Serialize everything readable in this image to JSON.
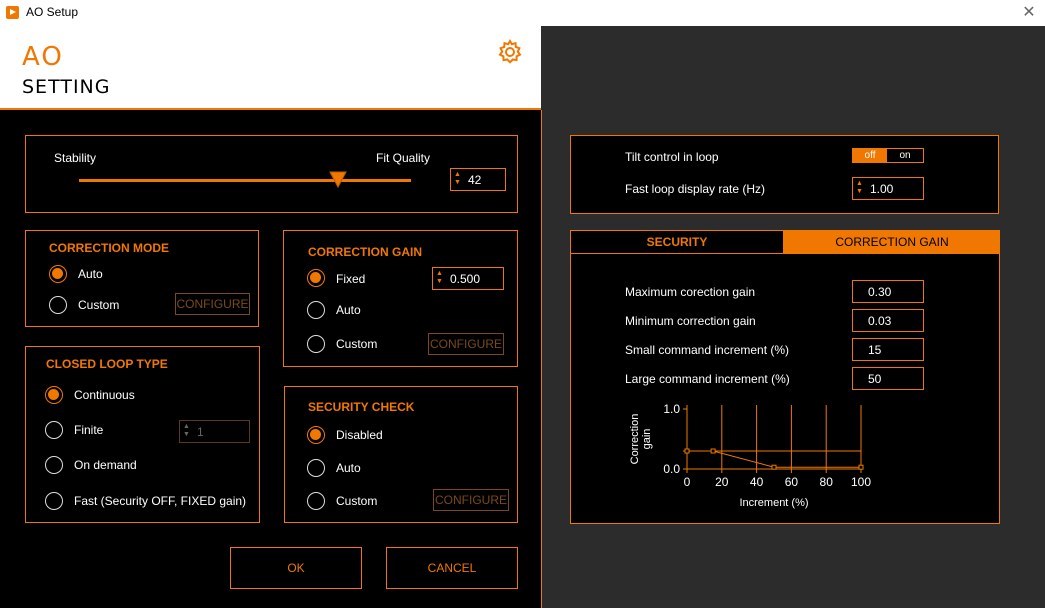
{
  "window": {
    "title": "AO Setup",
    "close": "✕"
  },
  "header": {
    "line1": "AO",
    "line2": "SETTING"
  },
  "stability": {
    "left_label": "Stability",
    "right_label": "Fit Quality",
    "slider_value": 0.78,
    "value": "42"
  },
  "correction_mode": {
    "title": "CORRECTION MODE",
    "options": [
      "Auto",
      "Custom"
    ],
    "selected": "Auto",
    "configure": "CONFIGURE"
  },
  "correction_gain": {
    "title": "CORRECTION GAIN",
    "options": [
      "Fixed",
      "Auto",
      "Custom"
    ],
    "selected": "Fixed",
    "fixed_value": "0.500",
    "configure": "CONFIGURE"
  },
  "closed_loop": {
    "title": "CLOSED LOOP TYPE",
    "options": [
      "Continuous",
      "Finite",
      "On demand",
      "Fast (Security OFF, FIXED gain)"
    ],
    "selected": "Continuous",
    "finite_value": "1"
  },
  "security_check": {
    "title": "SECURITY CHECK",
    "options": [
      "Disabled",
      "Auto",
      "Custom"
    ],
    "selected": "Disabled",
    "configure": "CONFIGURE"
  },
  "buttons": {
    "ok": "OK",
    "cancel": "CANCEL"
  },
  "loop": {
    "tilt_label": "Tilt control in loop",
    "toggle_off": "off",
    "toggle_on": "on",
    "toggle_state": "off",
    "rate_label": "Fast loop display rate (Hz)",
    "rate_value": "1.00"
  },
  "tabs": [
    {
      "label": "SECURITY",
      "active": false
    },
    {
      "label": "CORRECTION GAIN",
      "active": true
    }
  ],
  "gain_params": [
    {
      "label": "Maximum corection gain",
      "value": "0.30"
    },
    {
      "label": "Minimum correction gain",
      "value": "0.03"
    },
    {
      "label": "Small command increment (%)",
      "value": "15"
    },
    {
      "label": "Large command increment (%)",
      "value": "50"
    }
  ],
  "chart_data": {
    "type": "line",
    "xlabel": "Increment (%)",
    "ylabel": "Correction gain",
    "xlim": [
      0,
      100
    ],
    "ylim": [
      0,
      1.0
    ],
    "xticks": [
      "0",
      "20",
      "40",
      "60",
      "80",
      "100"
    ],
    "yticks": [
      "0.0",
      "1.0"
    ],
    "series": [
      {
        "x": [
          0,
          15,
          50,
          100
        ],
        "y": [
          0.3,
          0.3,
          0.03,
          0.03
        ]
      }
    ]
  },
  "colors": {
    "accent": "#f07800",
    "panel_bg": "#000000",
    "window_bg": "#2c2c2c"
  }
}
